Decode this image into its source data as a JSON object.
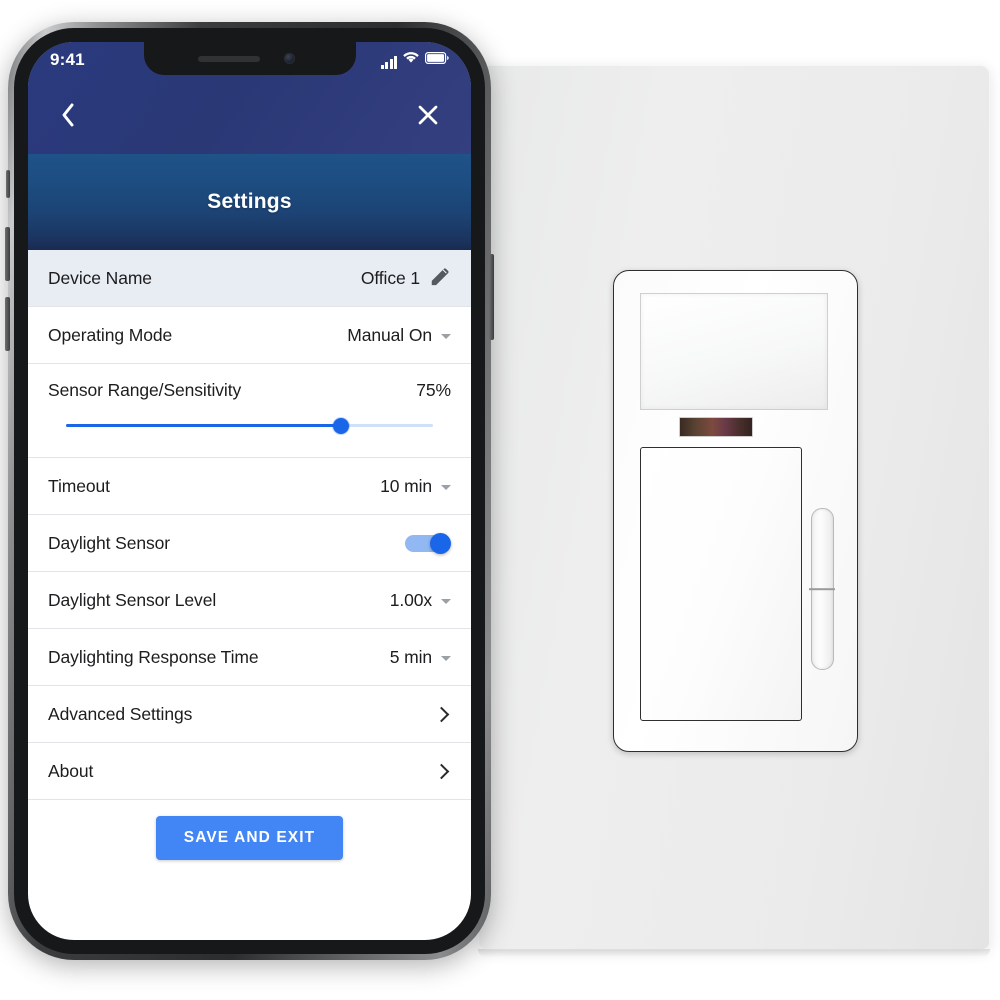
{
  "status_bar": {
    "time": "9:41",
    "icons": [
      "cellular-signal-icon",
      "wifi-icon",
      "battery-icon"
    ]
  },
  "header": {
    "title": "Settings",
    "back_icon": "back-chevron-icon",
    "close_icon": "close-x-icon",
    "top_color": "#2b3a7e",
    "bottom_color": "#1f5288"
  },
  "settings": {
    "device_name": {
      "label": "Device Name",
      "value": "Office 1",
      "icon": "pencil-edit-icon"
    },
    "operating_mode": {
      "label": "Operating Mode",
      "value": "Manual On",
      "icon": "chevron-down-icon"
    },
    "sensor_range": {
      "label": "Sensor Range/Sensitivity",
      "value": "75%",
      "slider_percent": 75
    },
    "timeout": {
      "label": "Timeout",
      "value": "10 min",
      "icon": "chevron-down-icon"
    },
    "daylight_sensor": {
      "label": "Daylight Sensor",
      "toggle_on": true
    },
    "daylight_sensor_level": {
      "label": "Daylight Sensor Level",
      "value": "1.00x",
      "icon": "chevron-down-icon"
    },
    "daylighting_response_time": {
      "label": "Daylighting Response Time",
      "value": "5 min",
      "icon": "chevron-down-icon"
    },
    "advanced_settings": {
      "label": "Advanced Settings",
      "icon": "chevron-right-icon"
    },
    "about": {
      "label": "About",
      "icon": "chevron-right-icon"
    }
  },
  "actions": {
    "save_and_exit": "SAVE AND EXIT",
    "save_color": "#4285f4"
  },
  "device_photo": {
    "name": "occupancy-sensor-wall-switch",
    "plate_color": "#ebebeb",
    "parts": [
      "sensor-lens-window",
      "ir-led-indicator-strip",
      "main-paddle-switch",
      "side-dimmer-rocker"
    ]
  },
  "accent_colors": {
    "slider": "#1967e8",
    "toggle": "#1967e8",
    "highlight_row": "#e8edf4"
  }
}
